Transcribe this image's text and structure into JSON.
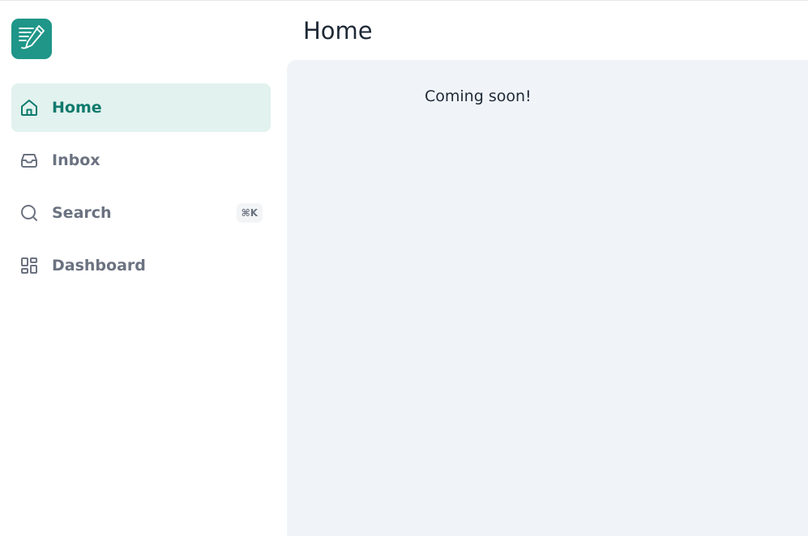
{
  "header": {
    "title": "Home"
  },
  "sidebar": {
    "logo_icon": "notebook-pencil-icon",
    "items": [
      {
        "label": "Home",
        "icon": "home-icon",
        "active": true
      },
      {
        "label": "Inbox",
        "icon": "inbox-icon",
        "active": false
      },
      {
        "label": "Search",
        "icon": "search-icon",
        "active": false,
        "shortcut": "⌘K"
      },
      {
        "label": "Dashboard",
        "icon": "dashboard-icon",
        "active": false
      }
    ]
  },
  "main": {
    "message": "Coming soon!"
  },
  "colors": {
    "brand": "#1f9688",
    "active_bg": "#e2f2ee",
    "active_text": "#0e7a6d",
    "muted_text": "#6b7280",
    "content_bg": "#f0f4f8"
  }
}
